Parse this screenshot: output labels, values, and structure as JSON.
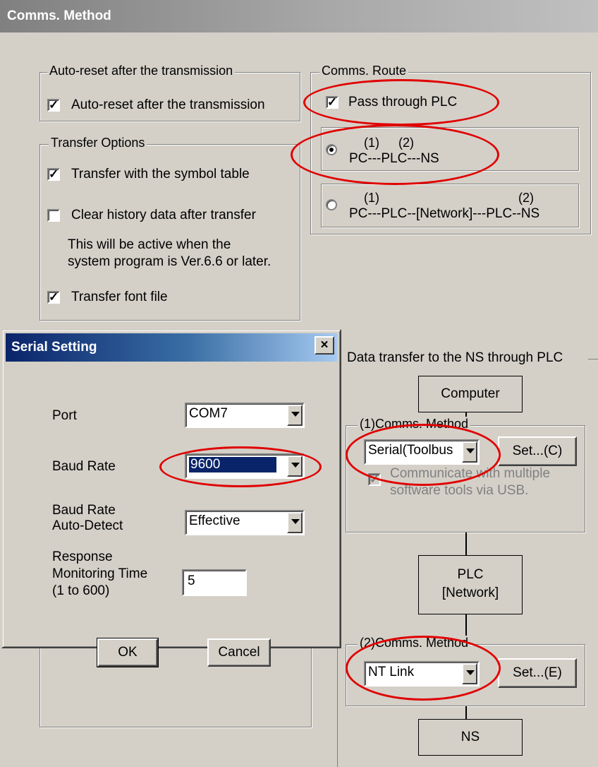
{
  "window": {
    "title": "Comms. Method"
  },
  "auto_reset": {
    "group_label": "Auto-reset after the transmission",
    "checkbox_label": "Auto-reset after the transmission",
    "checked": true
  },
  "transfer_options": {
    "group_label": "Transfer Options",
    "symbol_table_label": "Transfer with the symbol table",
    "clear_history_label": "Clear history data after transfer",
    "note_line1": "This will be active when the",
    "note_line2": "system program is Ver.6.6 or later.",
    "font_file_label": "Transfer font file"
  },
  "comms_route": {
    "group_label": "Comms. Route",
    "pass_through_label": "Pass through PLC",
    "route1": {
      "nums_a": "(1)",
      "nums_b": "(2)",
      "path": "PC---PLC---NS",
      "selected": true
    },
    "route2": {
      "nums_a": "(1)",
      "nums_b": "(2)",
      "path": "PC---PLC--[Network]---PLC--NS",
      "selected": false
    }
  },
  "data_transfer": {
    "label": "Data transfer to the NS through PLC",
    "computer_label": "Computer",
    "method1": {
      "group_label": "(1)Comms. Method",
      "combo_value": "Serial(Toolbus",
      "set_button": "Set...(C)",
      "multi_line1": "Communicate with multiple",
      "multi_line2": "software tools via USB."
    },
    "plc_line1": "PLC",
    "plc_line2": "[Network]",
    "method2": {
      "group_label": "(2)Comms. Method",
      "combo_value": "NT Link",
      "set_button": "Set...(E)"
    },
    "ns_label": "NS"
  },
  "serial_dialog": {
    "title": "Serial Setting",
    "close_glyph": "×",
    "port_label": "Port",
    "port_value": "COM7",
    "baud_label": "Baud Rate",
    "baud_value": "9600",
    "autodetect_line1": "Baud Rate",
    "autodetect_line2": "Auto-Detect",
    "autodetect_value": "Effective",
    "resp_line1": "Response",
    "resp_line2": "Monitoring Time",
    "resp_line3": "(1 to 600)",
    "resp_value": "5",
    "ok_label": "OK",
    "cancel_label": "Cancel"
  },
  "colors": {
    "highlight_ellipse": "#e00000",
    "selection": "#0a246a",
    "face": "#d4d0c8"
  }
}
